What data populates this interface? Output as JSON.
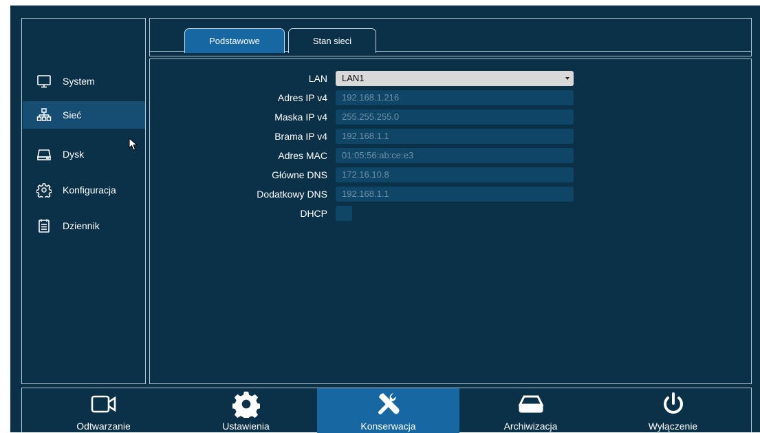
{
  "sidebar": {
    "items": [
      {
        "label": "System",
        "icon": "monitor-icon"
      },
      {
        "label": "Sieć",
        "icon": "network-icon",
        "active": true
      },
      {
        "label": "Dysk",
        "icon": "disk-icon"
      },
      {
        "label": "Konfiguracja",
        "icon": "gear-icon"
      },
      {
        "label": "Dziennik",
        "icon": "log-icon"
      }
    ]
  },
  "tabs": [
    {
      "label": "Podstawowe",
      "active": true
    },
    {
      "label": "Stan sieci",
      "active": false
    }
  ],
  "form": {
    "lan": {
      "label": "LAN",
      "value": "LAN1"
    },
    "ipv4": {
      "label": "Adres IP v4",
      "value": "192.168.1.216"
    },
    "mask": {
      "label": "Maska IP v4",
      "value": "255.255.255.0"
    },
    "gateway": {
      "label": "Brama IP v4",
      "value": "192.168.1.1"
    },
    "mac": {
      "label": "Adres MAC",
      "value": "01:05:56:ab:ce:e3"
    },
    "dns1": {
      "label": "Główne DNS",
      "value": "172.16.10.8"
    },
    "dns2": {
      "label": "Dodatkowy DNS",
      "value": "192.168.1.1"
    },
    "dhcp": {
      "label": "DHCP",
      "checked": false
    }
  },
  "bottom": {
    "items": [
      {
        "label": "Odtwarzanie",
        "icon": "video-camera-icon"
      },
      {
        "label": "Ustawienia",
        "icon": "gear-icon"
      },
      {
        "label": "Konserwacja",
        "icon": "tools-icon",
        "active": true
      },
      {
        "label": "Archiwizacja",
        "icon": "archive-tray-icon"
      },
      {
        "label": "Wyłączenie",
        "icon": "power-icon"
      }
    ]
  },
  "colors": {
    "background": "#0b3149",
    "accent": "#1767a3",
    "sidebar_active": "#164d73",
    "field": "#0f4668",
    "border": "#b6c9d6"
  }
}
